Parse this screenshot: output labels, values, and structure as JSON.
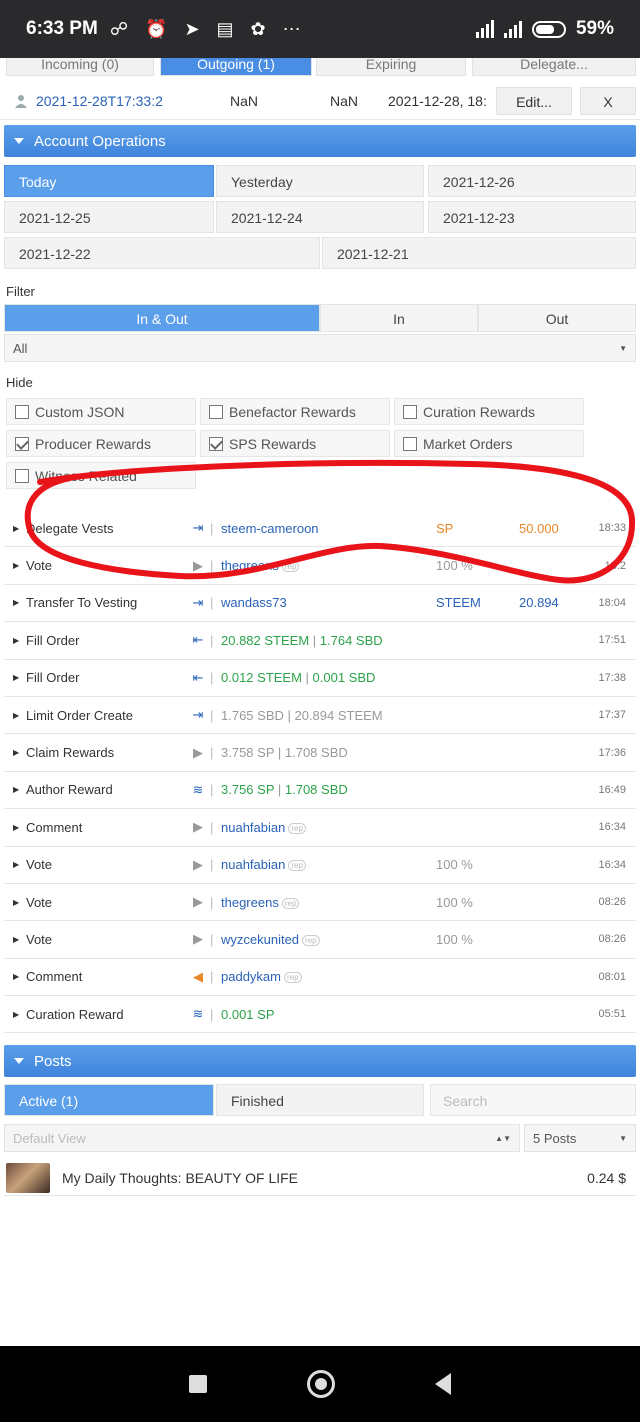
{
  "status_bar": {
    "time": "6:33 PM",
    "notification_icons": "☍ ⏰ ➤ ▤ ✿ ⋯",
    "battery_percent": "59"
  },
  "top_tabs": [
    "Incoming (0)",
    "Outgoing (1)",
    "Expiring",
    "Delegate..."
  ],
  "delegation": {
    "date": "2021-12-28T17:33:2",
    "col1": "NaN",
    "col2": "NaN",
    "expires": "2021-12-28, 18:",
    "edit_label": "Edit...",
    "close_label": "X"
  },
  "account_operations": {
    "title": "Account Operations",
    "days": [
      "Today",
      "Yesterday",
      "2021-12-26",
      "2021-12-25",
      "2021-12-24",
      "2021-12-23",
      "2021-12-22",
      "2021-12-21"
    ]
  },
  "filter": {
    "label": "Filter",
    "segments": [
      "In & Out",
      "In",
      "Out"
    ],
    "select_value": "All"
  },
  "hide": {
    "label": "Hide",
    "options": [
      {
        "label": "Custom JSON",
        "checked": false
      },
      {
        "label": "Benefactor Rewards",
        "checked": false
      },
      {
        "label": "Curation Rewards",
        "checked": false
      },
      {
        "label": "Producer Rewards",
        "checked": true
      },
      {
        "label": "SPS Rewards",
        "checked": true
      },
      {
        "label": "Market Orders",
        "checked": false
      },
      {
        "label": "Witness Related",
        "checked": false
      }
    ]
  },
  "operations": [
    {
      "type": "Delegate Vests",
      "dir": "in",
      "detail": "steem-cameroon",
      "c1": "SP",
      "amount": "50.000",
      "time": "18:33"
    },
    {
      "type": "Vote",
      "dir": "out",
      "detail": "thegreens",
      "c1": "100 %",
      "amount": "",
      "time": "18:2"
    },
    {
      "type": "Transfer To Vesting",
      "dir": "in",
      "detail": "wandass73",
      "c1": "STEEM",
      "amount": "20.894",
      "time": "18:04"
    },
    {
      "type": "Fill Order",
      "dir": "inout",
      "detail": "20.882 STEEM",
      "detail2": "1.764 SBD",
      "c1": "",
      "amount": "",
      "time": "17:51"
    },
    {
      "type": "Fill Order",
      "dir": "inout",
      "detail": "0.012 STEEM",
      "detail2": "0.001 SBD",
      "c1": "",
      "amount": "",
      "time": "17:38"
    },
    {
      "type": "Limit Order Create",
      "dir": "in",
      "detail": "1.765 SBD",
      "detail2": "20.894 STEEM",
      "c1": "",
      "amount": "",
      "time": "17:37"
    },
    {
      "type": "Claim Rewards",
      "dir": "out",
      "detail": "3.758 SP",
      "detail2": "1.708 SBD",
      "c1": "",
      "amount": "",
      "time": "17:36"
    },
    {
      "type": "Author Reward",
      "dir": "steem",
      "detail": "3.756 SP",
      "detail2": "1.708 SBD",
      "c1": "",
      "amount": "",
      "time": "16:49"
    },
    {
      "type": "Comment",
      "dir": "out",
      "detail": "nuahfabian",
      "c1": "",
      "amount": "",
      "time": "16:34"
    },
    {
      "type": "Vote",
      "dir": "out",
      "detail": "nuahfabian",
      "c1": "100 %",
      "amount": "",
      "time": "16:34"
    },
    {
      "type": "Vote",
      "dir": "out",
      "detail": "thegreens",
      "c1": "100 %",
      "amount": "",
      "time": "08:26"
    },
    {
      "type": "Vote",
      "dir": "out",
      "detail": "wyzcekunited",
      "c1": "100 %",
      "amount": "",
      "time": "08:26"
    },
    {
      "type": "Comment",
      "dir": "left",
      "detail": "paddykam",
      "c1": "",
      "amount": "",
      "time": "08:01"
    },
    {
      "type": "Curation Reward",
      "dir": "steem",
      "detail": "0.001 SP",
      "c1": "",
      "amount": "",
      "time": "05:51"
    }
  ],
  "posts": {
    "title": "Posts",
    "tabs": [
      "Active (1)",
      "Finished"
    ],
    "search_placeholder": "Search",
    "view_select": "Default View",
    "count_select": "5 Posts",
    "items": [
      {
        "title": "My Daily Thoughts: BEAUTY OF LIFE",
        "price": "0.24 $"
      }
    ]
  },
  "colors": {
    "accent": "#4a8de5",
    "green": "#2ca34a",
    "orange": "#e8882a",
    "annotation": "#e8141a"
  }
}
